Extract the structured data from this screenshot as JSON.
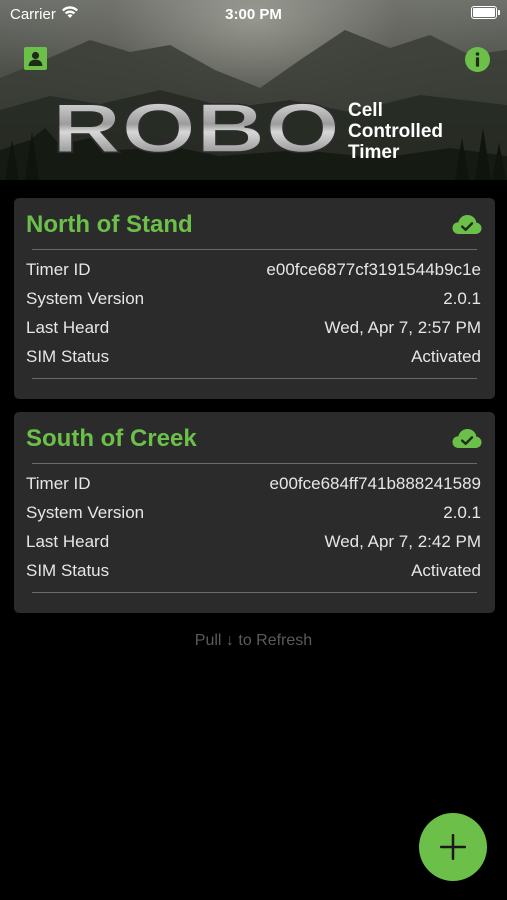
{
  "status_bar": {
    "carrier": "Carrier",
    "time": "3:00 PM"
  },
  "header": {
    "logo_text": "ROBO",
    "logo_sub": [
      "Cell",
      "Controlled",
      "Timer"
    ],
    "accent_color": "#6cc04a"
  },
  "timers": [
    {
      "name": "North of Stand",
      "rows": [
        {
          "label": "Timer ID",
          "value": "e00fce6877cf3191544b9c1e"
        },
        {
          "label": "System Version",
          "value": "2.0.1"
        },
        {
          "label": "Last Heard",
          "value": "Wed, Apr 7, 2:57 PM"
        },
        {
          "label": "SIM Status",
          "value": "Activated"
        }
      ]
    },
    {
      "name": "South of Creek",
      "rows": [
        {
          "label": "Timer ID",
          "value": "e00fce684ff741b888241589"
        },
        {
          "label": "System Version",
          "value": "2.0.1"
        },
        {
          "label": "Last Heard",
          "value": "Wed, Apr 7, 2:42 PM"
        },
        {
          "label": "SIM Status",
          "value": "Activated"
        }
      ]
    }
  ],
  "refresh_hint": "Pull ↓ to Refresh",
  "icons": {
    "contacts": "contact-card-icon",
    "info": "info-icon",
    "cloud": "cloud-check-icon",
    "add": "plus-icon"
  }
}
